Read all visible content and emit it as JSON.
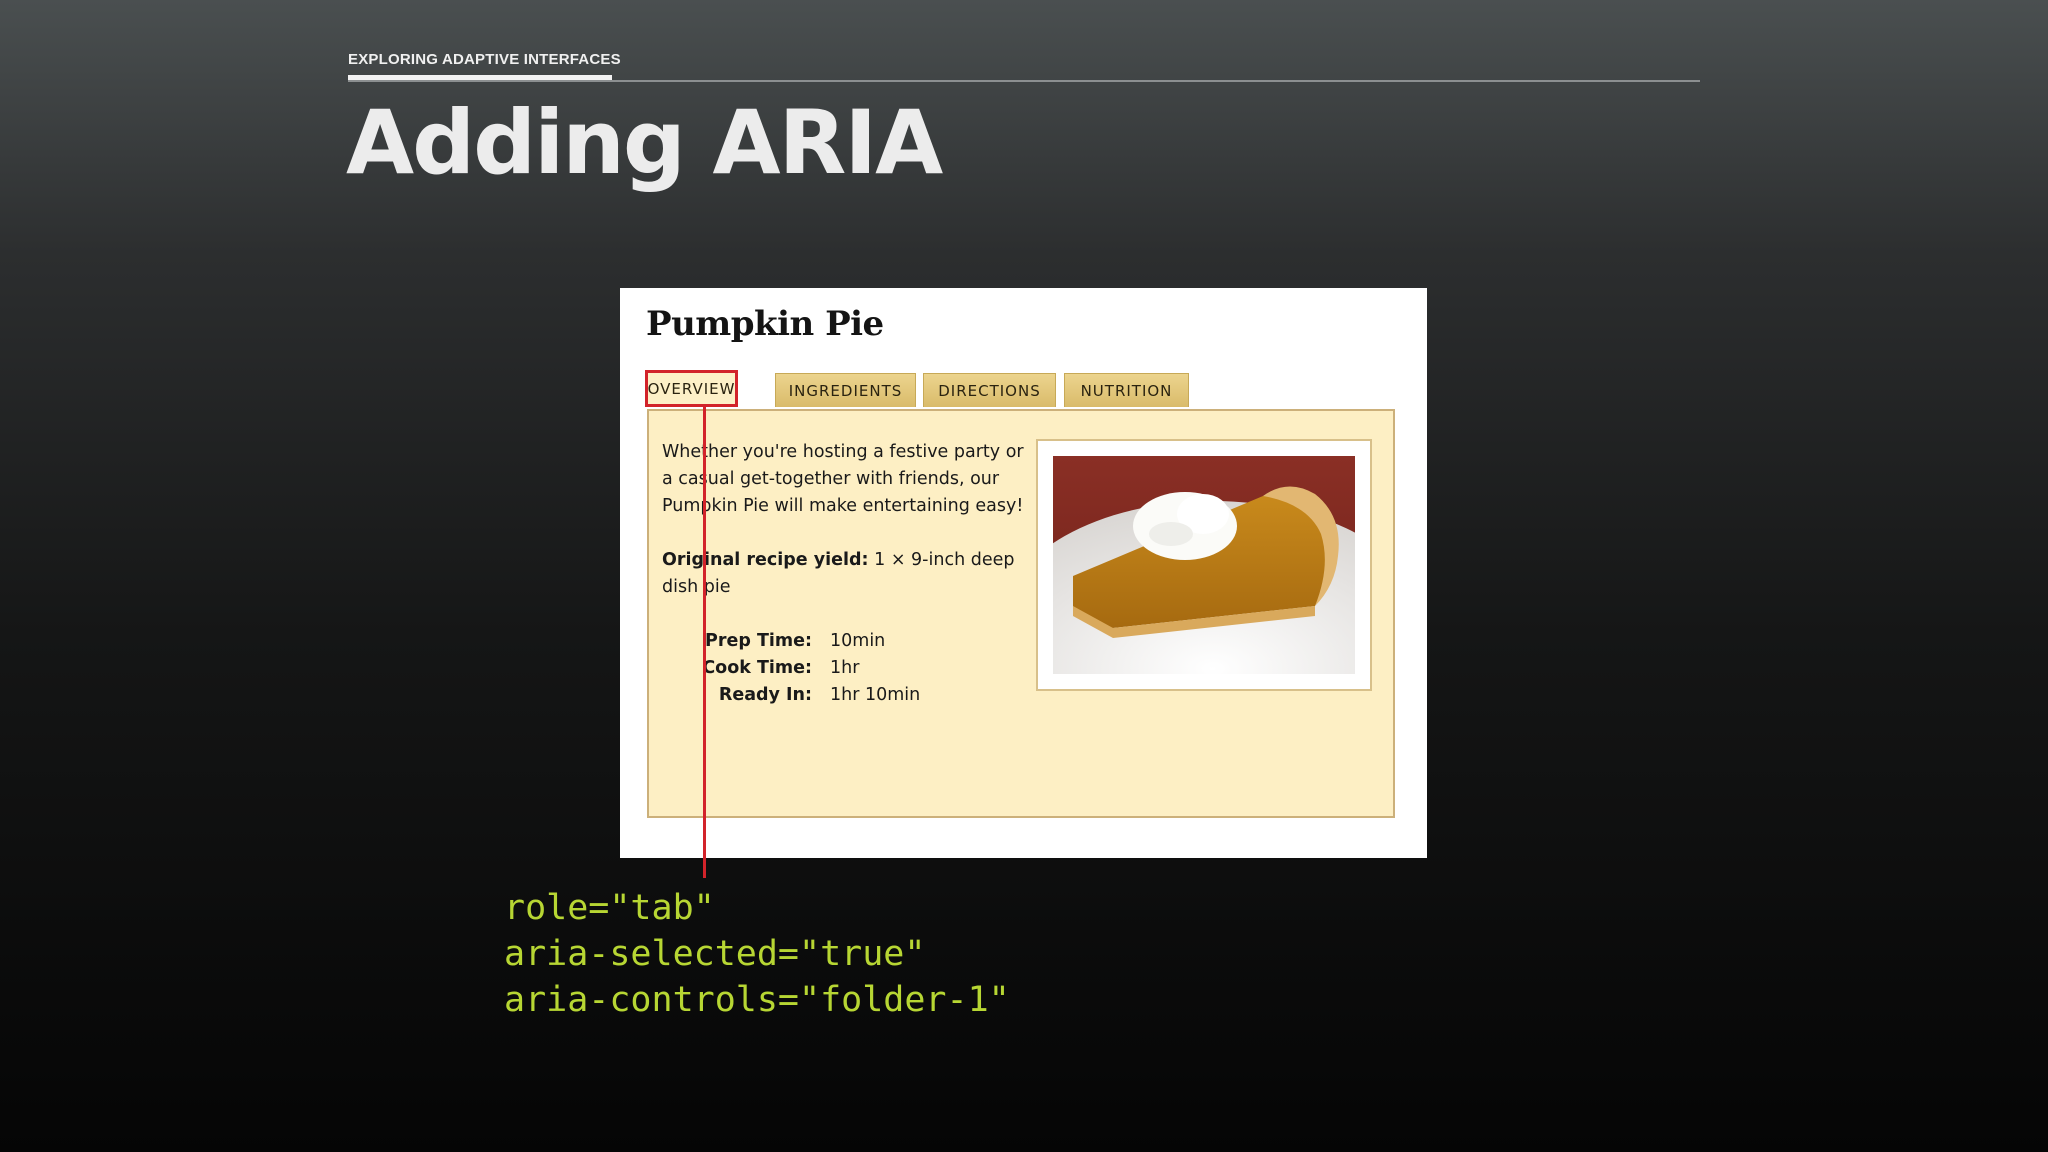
{
  "slide": {
    "eyebrow": "EXPLORING ADAPTIVE INTERFACES",
    "title": "Adding ARIA"
  },
  "recipe": {
    "title": "Pumpkin Pie",
    "tabs": [
      {
        "label": "OVERVIEW",
        "selected": true
      },
      {
        "label": "INGREDIENTS",
        "selected": false
      },
      {
        "label": "DIRECTIONS",
        "selected": false
      },
      {
        "label": "NUTRITION",
        "selected": false
      }
    ],
    "intro": "Whether you're hosting a festive party or a casual get-together with friends, our Pumpkin Pie will make entertaining easy!",
    "yield_label": "Original recipe yield:",
    "yield_value": " 1 × 9-inch deep dish pie",
    "times": [
      {
        "label": "Prep Time:",
        "value": "10min"
      },
      {
        "label": "Cook Time:",
        "value": "1hr"
      },
      {
        "label": "Ready In:",
        "value": "1hr 10min"
      }
    ],
    "photo_icon": "pumpkin-pie-slice-image"
  },
  "code_lines": [
    "role=\"tab\"",
    "aria-selected=\"true\"",
    "aria-controls=\"folder-1\""
  ],
  "colors": {
    "highlight": "#d2232a",
    "code": "#b7d633",
    "panel": "#fdefc4",
    "tab": "#e2c77b"
  }
}
